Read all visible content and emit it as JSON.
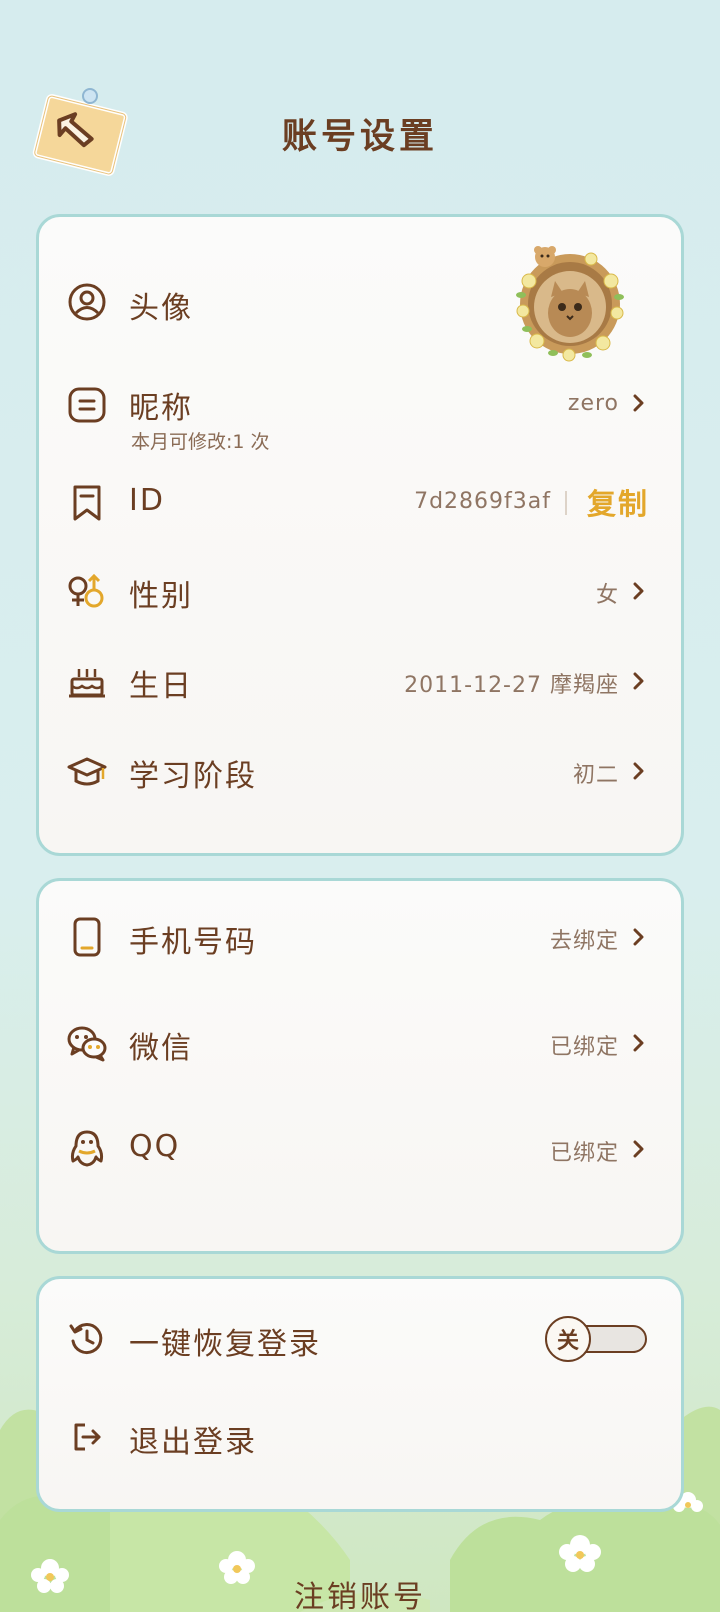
{
  "header": {
    "title": "账号设置",
    "back_icon": "back-arrow-note-icon"
  },
  "profile": {
    "avatar_label": "头像",
    "nickname_label": "昵称",
    "nickname_hint": "本月可修改:1 次",
    "nickname_value": "zero",
    "id_label": "ID",
    "id_value": "7d2869f3af",
    "copy_label": "复制",
    "gender_label": "性别",
    "gender_value": "女",
    "birthday_label": "生日",
    "birthday_value": "2011-12-27 摩羯座",
    "stage_label": "学习阶段",
    "stage_value": "初二"
  },
  "bindings": {
    "phone_label": "手机号码",
    "phone_value": "去绑定",
    "wechat_label": "微信",
    "wechat_value": "已绑定",
    "qq_label": "QQ",
    "qq_value": "已绑定"
  },
  "session": {
    "restore_label": "一键恢复登录",
    "restore_toggle": "关",
    "restore_on": false,
    "logout_label": "退出登录"
  },
  "footer": {
    "cancel_account": "注销账号"
  },
  "colors": {
    "text_brown": "#6b3e22",
    "accent_gold": "#e3a72b",
    "card_border": "#a9d8d6",
    "bg_top": "#d6ecee",
    "hill_green": "#bfe09e"
  }
}
